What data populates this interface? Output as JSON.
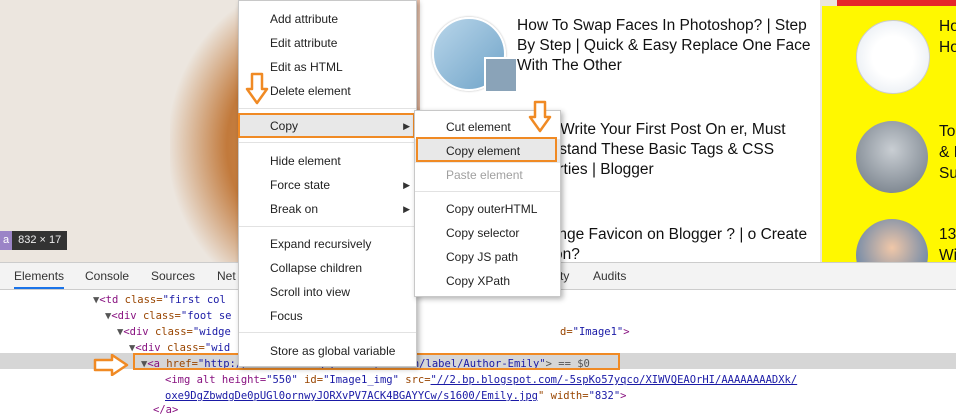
{
  "page": {
    "posts": [
      "How To Swap Faces In Photoshop? | Step By Step | Quick & Easy Replace One Face With The Other",
      "e You Write Your First Post On er, Must Understand These Basic Tags & CSS Properties | Blogger",
      "o Change Favicon on Blogger ? | o Create Favicon?"
    ],
    "sidebar": [
      "Ho\nHo",
      "To\n& I\nSu",
      "13\nWi"
    ],
    "size_tooltip": {
      "tag": "a",
      "size": "832 × 17"
    }
  },
  "context_menu": {
    "items": [
      "Add attribute",
      "Edit attribute",
      "Edit as HTML",
      "Delete element",
      "Copy",
      "Hide element",
      "Force state",
      "Break on",
      "Expand recursively",
      "Collapse children",
      "Scroll into view",
      "Focus",
      "Store as global variable"
    ]
  },
  "copy_submenu": {
    "items": [
      "Cut element",
      "Copy element",
      "Paste element",
      "Copy outerHTML",
      "Copy selector",
      "Copy JS path",
      "Copy XPath"
    ]
  },
  "devtools": {
    "tabs": [
      "Elements",
      "Console",
      "Sources",
      "Net",
      "ty",
      "Audits"
    ],
    "lines": [
      {
        "tag": "<td",
        "attr": " class=",
        "val": "\"first col"
      },
      {
        "tag": "<div",
        "attr": " class=",
        "val": "\"foot se"
      },
      {
        "tag": "<div",
        "attr": " class=",
        "val": "\"widge",
        "tail_attr": "d=",
        "tail_val": "\"Image1\"",
        "tail_tag": ">"
      },
      {
        "tag": "<div",
        "attr": " class=",
        "val": "\"wid"
      },
      {
        "tag": "<a",
        "attr": " href=",
        "val": "\"http://www.aaa.blogspot.com/search/label/Author-Emily\"",
        "suffix": "> == $0"
      },
      {
        "img_line1_a": "<img alt height=",
        "img_line1_b": "\"550\"",
        "img_line1_c": " id=",
        "img_line1_d": "\"Image1_img\"",
        "img_line1_e": " src=",
        "img_line1_f": "\"//2.bp.blogspot.com/-5spKo57yqco/XIWVQEAOrHI/AAAAAAAADXk/"
      },
      {
        "img_line2": "oxe9DgZbwdgDe0pUGl0ornwyJORXvPV7ACK4BGAYYCw/s1600/Emily.jpg",
        "img_line2_b": "\" width=",
        "img_line2_c": "\"832\"",
        "img_line2_d": ">"
      },
      {
        "close": "</a>"
      }
    ]
  },
  "colors": {
    "highlight_orange": "#f08a24",
    "sidebar_yellow": "#fff800",
    "accent_red": "#e5262b"
  }
}
